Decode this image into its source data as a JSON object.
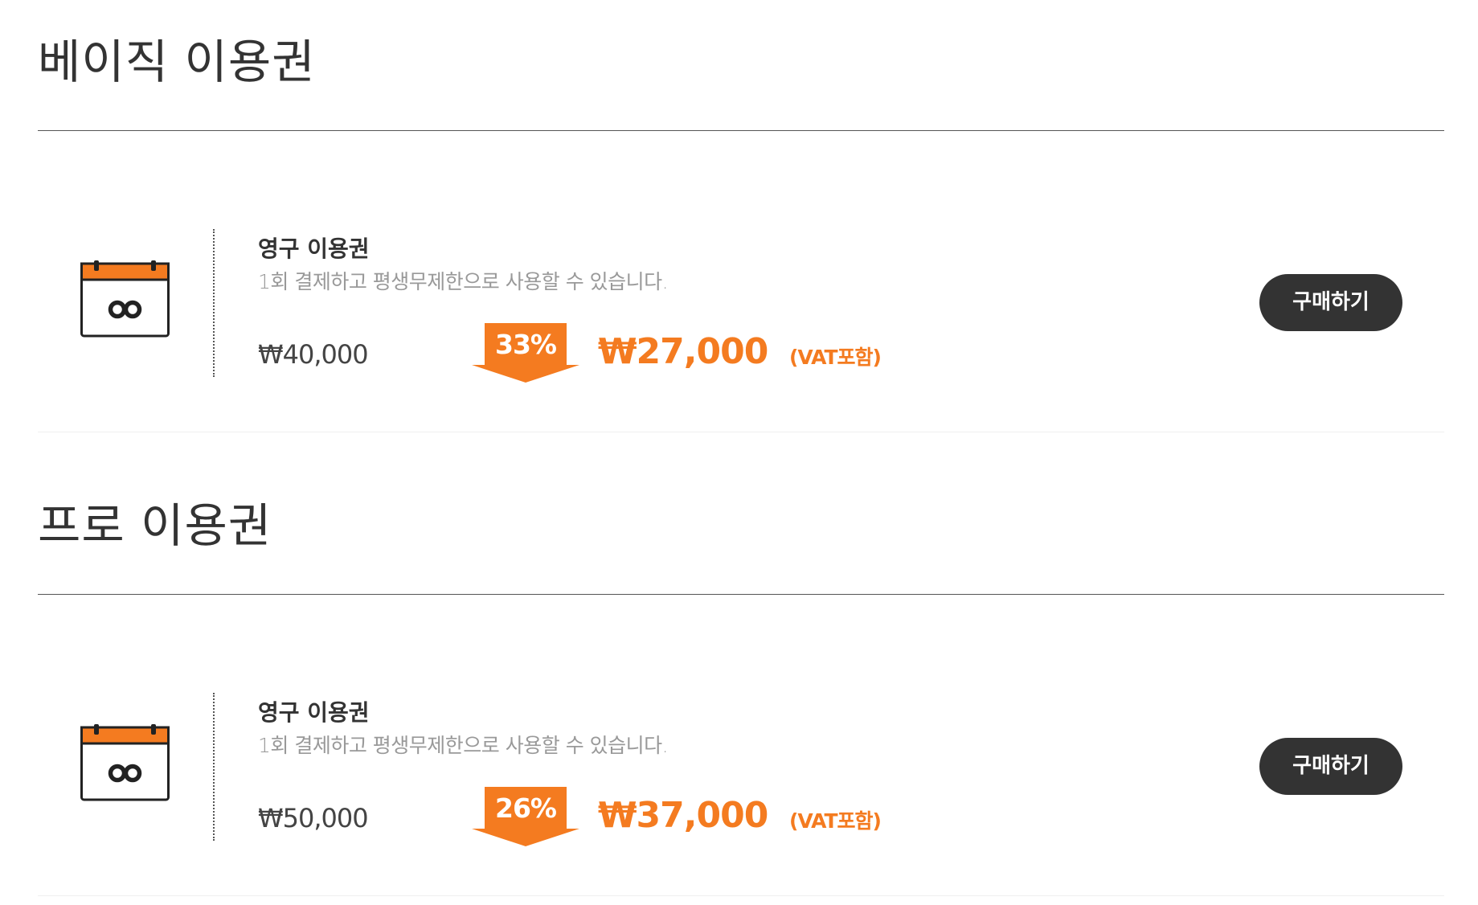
{
  "sections": [
    {
      "title": "베이직 이용권",
      "plan": {
        "name": "영구 이용권",
        "description": "1회 결제하고 평생무제한으로 사용할 수 있습니다.",
        "original_price": "₩40,000",
        "discount": "33%",
        "sale_price": "₩27,000",
        "vat_note": "(VAT포함)",
        "buy_label": "구매하기",
        "icon": "calendar-infinity-icon"
      }
    },
    {
      "title": "프로 이용권",
      "plan": {
        "name": "영구 이용권",
        "description": "1회 결제하고 평생무제한으로 사용할 수 있습니다.",
        "original_price": "₩50,000",
        "discount": "26%",
        "sale_price": "₩37,000",
        "vat_note": "(VAT포함)",
        "buy_label": "구매하기",
        "icon": "calendar-infinity-icon"
      }
    }
  ],
  "colors": {
    "accent": "#f47b20",
    "button_bg": "#333333",
    "text": "#333333",
    "muted": "#999999"
  }
}
